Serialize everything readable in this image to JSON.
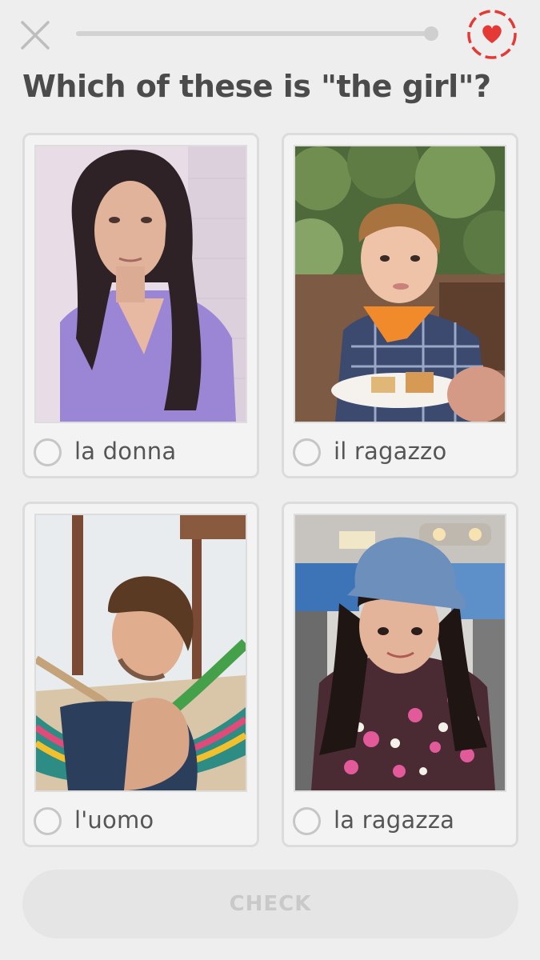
{
  "header": {
    "progress_fraction": 1.0,
    "progress_color": "#d2d2d2",
    "heart_ring_color": "#e53935",
    "heart_color": "#e53935",
    "close_icon": "close-icon",
    "hearts_icon": "heart-icon"
  },
  "question": "Which of these is \"the girl\"?",
  "choices": [
    {
      "label": "la donna",
      "image": "photo of a young woman with long dark hair in a purple top",
      "selected": false
    },
    {
      "label": "il ragazzo",
      "image": "photo of a small boy with an orange bandana at a table",
      "selected": false
    },
    {
      "label": "l'uomo",
      "image": "photo of a young man lying in a colorful hammock",
      "selected": false
    },
    {
      "label": "la ragazza",
      "image": "photo of a little girl in a blue cap and floral jacket in a car",
      "selected": false
    }
  ],
  "footer": {
    "check_label": "CHECK",
    "check_enabled": false
  }
}
